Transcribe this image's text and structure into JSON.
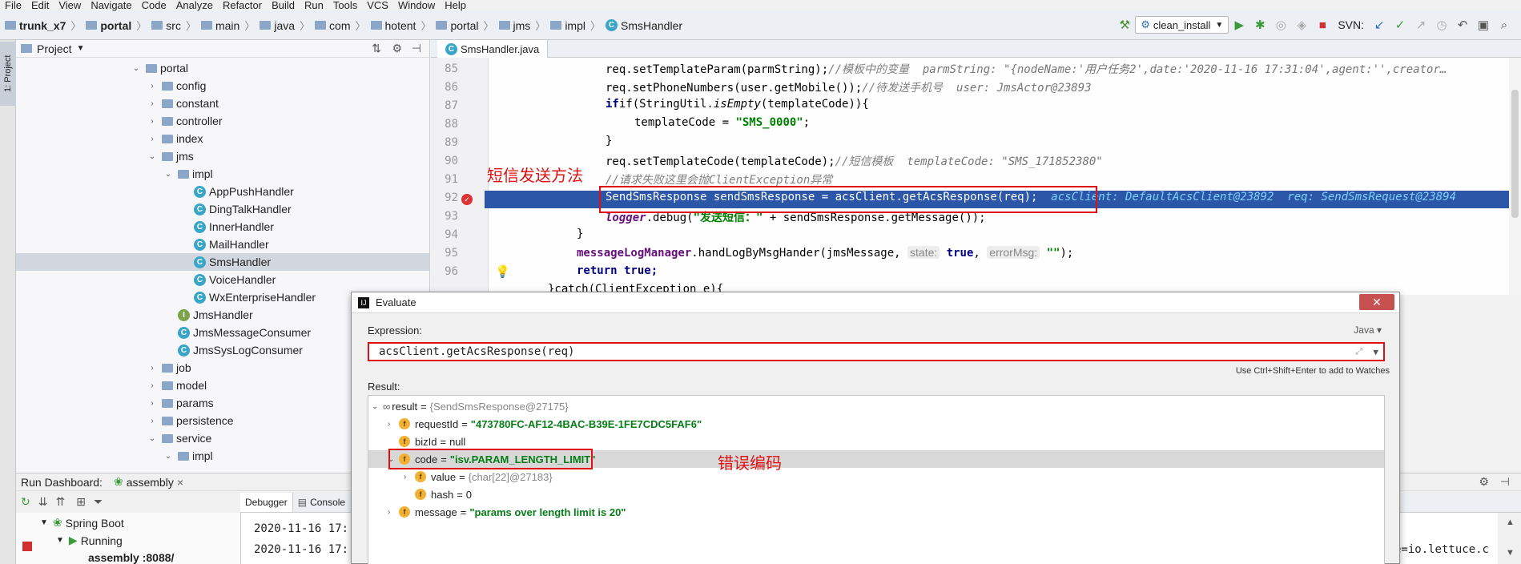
{
  "menu": [
    "File",
    "Edit",
    "View",
    "Navigate",
    "Code",
    "Analyze",
    "Refactor",
    "Build",
    "Run",
    "Tools",
    "VCS",
    "Window",
    "Help"
  ],
  "breadcrumbs": [
    "trunk_x7",
    "portal",
    "src",
    "main",
    "java",
    "com",
    "hotent",
    "portal",
    "jms",
    "impl",
    "SmsHandler"
  ],
  "toolbar": {
    "run_config": "clean_install",
    "svn_label": "SVN:"
  },
  "tool_stripe": {
    "project_tab": "1: Project"
  },
  "project_panel": {
    "title": "Project",
    "tree": [
      {
        "label": "portal",
        "type": "folder",
        "depth": 0,
        "expanded": true
      },
      {
        "label": "config",
        "type": "folder",
        "depth": 1,
        "expanded": false
      },
      {
        "label": "constant",
        "type": "folder",
        "depth": 1,
        "expanded": false
      },
      {
        "label": "controller",
        "type": "folder",
        "depth": 1,
        "expanded": false
      },
      {
        "label": "index",
        "type": "folder",
        "depth": 1,
        "expanded": false
      },
      {
        "label": "jms",
        "type": "folder",
        "depth": 1,
        "expanded": true
      },
      {
        "label": "impl",
        "type": "folder",
        "depth": 2,
        "expanded": true
      },
      {
        "label": "AppPushHandler",
        "type": "class",
        "depth": 3
      },
      {
        "label": "DingTalkHandler",
        "type": "class",
        "depth": 3
      },
      {
        "label": "InnerHandler",
        "type": "class",
        "depth": 3
      },
      {
        "label": "MailHandler",
        "type": "class",
        "depth": 3
      },
      {
        "label": "SmsHandler",
        "type": "class",
        "depth": 3,
        "selected": true
      },
      {
        "label": "VoiceHandler",
        "type": "class",
        "depth": 3
      },
      {
        "label": "WxEnterpriseHandler",
        "type": "class",
        "depth": 3
      },
      {
        "label": "JmsHandler",
        "type": "interface",
        "depth": 2
      },
      {
        "label": "JmsMessageConsumer",
        "type": "class",
        "depth": 2
      },
      {
        "label": "JmsSysLogConsumer",
        "type": "class",
        "depth": 2
      },
      {
        "label": "job",
        "type": "folder",
        "depth": 1,
        "expanded": false
      },
      {
        "label": "model",
        "type": "folder",
        "depth": 1,
        "expanded": false
      },
      {
        "label": "params",
        "type": "folder",
        "depth": 1,
        "expanded": false
      },
      {
        "label": "persistence",
        "type": "folder",
        "depth": 1,
        "expanded": false
      },
      {
        "label": "service",
        "type": "folder",
        "depth": 1,
        "expanded": true
      },
      {
        "label": "impl",
        "type": "folder",
        "depth": 2,
        "expanded": true
      }
    ]
  },
  "editor": {
    "tab": "SmsHandler.java",
    "line_numbers": [
      "85",
      "86",
      "87",
      "88",
      "89",
      "90",
      "91",
      "92",
      "93",
      "94",
      "95",
      "96"
    ],
    "line85": {
      "code": "req.setTemplateParam(parmString);",
      "comment": "//模板中的变量",
      "hint": "parmString: \"{nodeName:'用户任务2',date:'2020-11-16 17:31:04',agent:'',creator…"
    },
    "line86": {
      "code": "req.setPhoneNumbers(user.getMobile());",
      "comment": "//待发送手机号",
      "hint": "user: JmsActor@23893"
    },
    "line87": {
      "pre": "if(StringUtil.",
      "method": "isEmpty",
      "post": "(templateCode)){"
    },
    "line88": {
      "pre": "templateCode = ",
      "str": "\"SMS_0000\"",
      "post": ";"
    },
    "line89": "}",
    "line90": {
      "code": "req.setTemplateCode(templateCode);",
      "comment": "//短信模板",
      "hint": "templateCode: \"SMS_171852380\""
    },
    "line91": "//请求失败这里会抛ClientException异常",
    "line92": {
      "code": "SendSmsResponse sendSmsResponse = acsClient.getAcsResponse(req);",
      "hint": "acsClient: DefaultAcsClient@23892  req: SendSmsRequest@23894"
    },
    "line93": {
      "field": "logger",
      "pre": ".debug(",
      "str": "\"发送短信：\"",
      "post": " + sendSmsResponse.getMessage());"
    },
    "line94": "}",
    "line95": {
      "field": "messageLogManager",
      "pre": ".handLogByMsgHander(jmsMessage, ",
      "p1": "state:",
      "kw": "true",
      "mid": ", ",
      "p2": "errorMsg:",
      "str": "\"\"",
      "post": ");"
    },
    "line96": {
      "kw": "return",
      "rest": " true;"
    },
    "line97": "}catch(ClientException e){",
    "annotation_method": "短信发送方法"
  },
  "evaluate": {
    "title": "Evaluate",
    "expression_label": "Expression:",
    "language": "Java ▾",
    "expression": "acsClient.getAcsResponse(req)",
    "watch_hint": "Use Ctrl+Shift+Enter to add to Watches",
    "result_label": "Result:",
    "result": {
      "root": {
        "name": "result",
        "value": "{SendSmsResponse@27175}"
      },
      "rows": [
        {
          "name": "requestId",
          "value": "\"473780FC-AF12-4BAC-B39E-1FE7CDC5FAF6\""
        },
        {
          "name": "bizId",
          "value": "null"
        },
        {
          "name": "code",
          "value": "\"isv.PARAM_LENGTH_LIMIT\""
        },
        {
          "name": "value",
          "value": "{char[22]@27183}"
        },
        {
          "name": "hash",
          "value": "0"
        },
        {
          "name": "message",
          "value": "\"params over length limit is 20\""
        }
      ]
    },
    "annotation_code": "错误编码"
  },
  "run_dashboard": {
    "title": "Run Dashboard:",
    "config_tab": "assembly",
    "tabs": [
      "Debugger",
      "Console"
    ],
    "tree": [
      "Spring Boot",
      "Running",
      "assembly :8088/"
    ],
    "console_lines": [
      "2020-11-16 17:",
      "2020-11-16 17:"
    ],
    "console_right": "e=io.lettuce.c"
  }
}
